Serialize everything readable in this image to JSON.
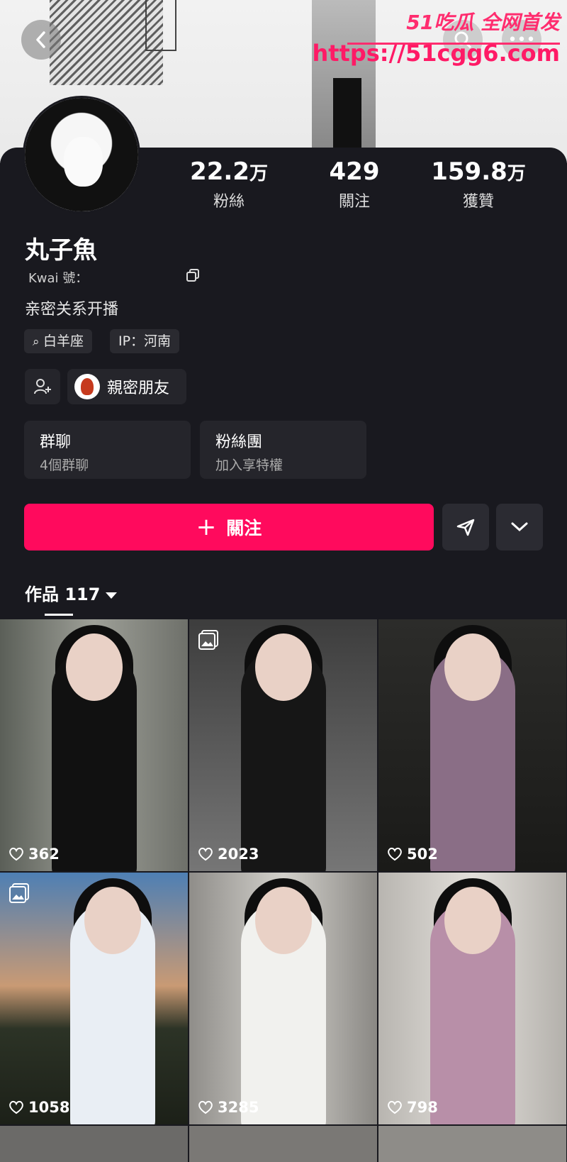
{
  "watermark": {
    "brand": "51吃瓜 全网首发",
    "url": "https://51cgg6.com"
  },
  "profile": {
    "name": "丸子魚",
    "kwai_id": "Kwai 號：",
    "bio": "亲密关系开播",
    "tags": [
      "白羊座",
      "IP：河南"
    ],
    "close_friends": "親密朋友"
  },
  "stats": [
    {
      "num": "22.2",
      "unit": "万",
      "label": "粉絲"
    },
    {
      "num": "429",
      "unit": "",
      "label": "關注"
    },
    {
      "num": "159.8",
      "unit": "万",
      "label": "獲贊"
    }
  ],
  "cards": [
    {
      "title": "群聊",
      "sub": "4個群聊"
    },
    {
      "title": "粉絲團",
      "sub": "加入享特權"
    }
  ],
  "actions": {
    "follow": "關注"
  },
  "works": {
    "label": "作品 117"
  },
  "posts": [
    {
      "likes": "362",
      "gallery": false
    },
    {
      "likes": "2023",
      "gallery": true
    },
    {
      "likes": "502",
      "gallery": false
    },
    {
      "likes": "1058",
      "gallery": true
    },
    {
      "likes": "3285",
      "gallery": false
    },
    {
      "likes": "798",
      "gallery": false
    }
  ],
  "colors": {
    "accent": "#ff0a5d",
    "background": "#19191f",
    "card": "#25252b"
  }
}
